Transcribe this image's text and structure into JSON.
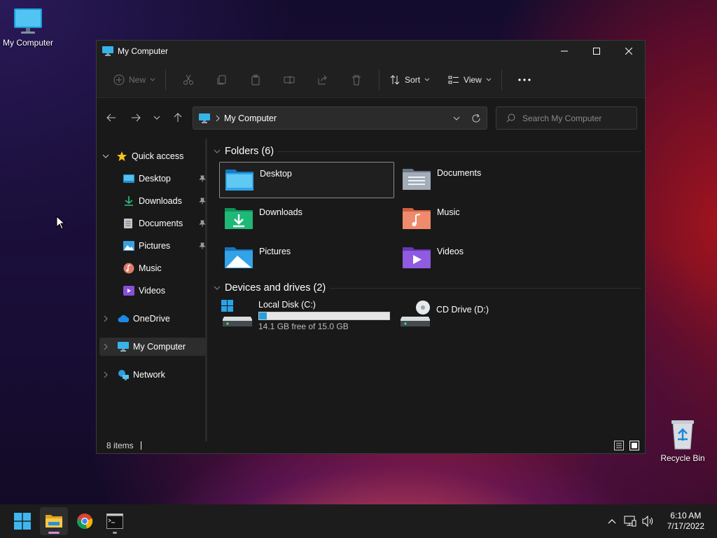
{
  "desktop": {
    "icons": [
      {
        "label": "My Computer"
      },
      {
        "label": "Recycle Bin"
      }
    ]
  },
  "window": {
    "title": "My Computer",
    "toolbar": {
      "new_label": "New",
      "sort_label": "Sort",
      "view_label": "View"
    },
    "address": {
      "crumb": "My Computer"
    },
    "search": {
      "placeholder": "Search My Computer"
    },
    "sidebar": {
      "quick_access": "Quick access",
      "items": [
        {
          "label": "Desktop",
          "pinned": true
        },
        {
          "label": "Downloads",
          "pinned": true
        },
        {
          "label": "Documents",
          "pinned": true
        },
        {
          "label": "Pictures",
          "pinned": true
        },
        {
          "label": "Music",
          "pinned": false
        },
        {
          "label": "Videos",
          "pinned": false
        }
      ],
      "onedrive": "OneDrive",
      "my_computer": "My Computer",
      "network": "Network"
    },
    "content": {
      "folders_header": "Folders (6)",
      "folders": [
        {
          "name": "Desktop"
        },
        {
          "name": "Documents"
        },
        {
          "name": "Downloads"
        },
        {
          "name": "Music"
        },
        {
          "name": "Pictures"
        },
        {
          "name": "Videos"
        }
      ],
      "drives_header": "Devices and drives (2)",
      "drives": [
        {
          "name": "Local Disk (C:)",
          "free_text": "14.1 GB free of 15.0 GB",
          "used_fraction": 0.06
        },
        {
          "name": "CD Drive (D:)"
        }
      ]
    },
    "status": {
      "items_count": "8 items"
    }
  },
  "taskbar": {
    "time": "6:10 AM",
    "date": "7/17/2022"
  },
  "colors": {
    "accent": "#26a0da",
    "window_bg": "#191919",
    "taskbar_bg": "#1c1c1c"
  }
}
